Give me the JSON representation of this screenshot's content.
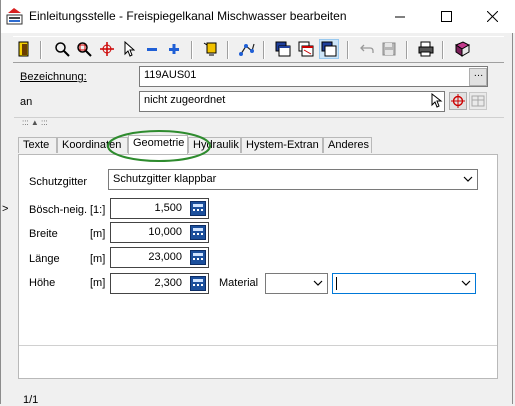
{
  "window": {
    "title": "Einleitungsstelle - Freispiegelkanal Mischwasser bearbeiten",
    "minimize_icon": "minimize-icon",
    "maximize_icon": "maximize-icon",
    "close_icon": "close-icon"
  },
  "toolbar": {
    "buttons": [
      {
        "name": "exit-icon"
      },
      {
        "name": "zoom-icon"
      },
      {
        "name": "zoom-window-icon"
      },
      {
        "name": "crosshair-icon"
      },
      {
        "name": "select-arrow-icon"
      },
      {
        "name": "minus-icon"
      },
      {
        "name": "plus-icon"
      },
      {
        "name": "light-icon"
      },
      {
        "name": "network-icon"
      },
      {
        "name": "window-1-icon"
      },
      {
        "name": "window-2-icon"
      },
      {
        "name": "window-3-icon"
      },
      {
        "name": "undo-icon"
      },
      {
        "name": "save-icon"
      },
      {
        "name": "print-icon"
      },
      {
        "name": "book-icon"
      }
    ]
  },
  "form": {
    "bezeichnung_label": "Bezeichnung:",
    "bezeichnung_value": "119AUS01",
    "an_label": "an",
    "an_value": "nicht zugeordnet",
    "splitter_glyph": ":::  ▲  :::"
  },
  "tabs": [
    {
      "label": "Texte",
      "active": false
    },
    {
      "label": "Koordinaten",
      "active": false
    },
    {
      "label": "Geometrie",
      "active": true
    },
    {
      "label": "Hydraulik",
      "active": false
    },
    {
      "label": "Hystem-Extran",
      "active": false
    },
    {
      "label": "Anderes",
      "active": false
    }
  ],
  "geometrie": {
    "schutzgitter_label": "Schutzgitter",
    "schutzgitter_value": "Schutzgitter klappbar",
    "boeschneig_label": "Bösch-neig.",
    "boeschneig_unit": "[1:]",
    "boeschneig_value": "1,500",
    "breite_label": "Breite",
    "breite_unit": "[m]",
    "breite_value": "10,000",
    "laenge_label": "Länge",
    "laenge_unit": "[m]",
    "laenge_value": "23,000",
    "hoehe_label": "Höhe",
    "hoehe_unit": "[m]",
    "hoehe_value": "2,300",
    "material_label": "Material",
    "material_value": "",
    "material2_value": ""
  },
  "status": {
    "record": "1/1",
    "row_marker": ">"
  },
  "colors": {
    "highlight_ellipse": "#2e8b2e",
    "calc_button": "#1b4f9c",
    "active_window_button": "#cce4f7"
  }
}
